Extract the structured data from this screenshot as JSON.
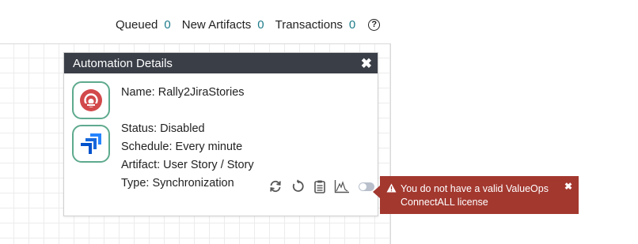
{
  "status_bar": {
    "queued_label": "Queued",
    "queued_count": "0",
    "new_artifacts_label": "New Artifacts",
    "new_artifacts_count": "0",
    "transactions_label": "Transactions",
    "transactions_count": "0",
    "help_icon": "help-circle-icon"
  },
  "panel": {
    "title": "Automation Details",
    "close_glyph": "✖",
    "name": "Name: Rally2JiraStories",
    "status": "Status: Disabled",
    "schedule": "Schedule: Every minute",
    "artifact": "Artifact: User Story / Story",
    "type": "Type: Synchronization",
    "source_app_icon": "rally-logo-icon",
    "target_app_icon": "jira-logo-icon",
    "toolbar_icons": [
      "sync-icon",
      "reset-icon",
      "clipboard-icon",
      "chart-icon"
    ],
    "enabled": false
  },
  "alert": {
    "message_line1": "You do not have a valid ValueOps",
    "message_line2": "ConnectALL license",
    "close_glyph": "✖",
    "icon": "warning-icon"
  },
  "colors": {
    "header_bg": "#3a3e47",
    "alert_bg": "#a3382f",
    "tile_border": "#5eaa8e",
    "count_color": "#1d7b8a",
    "rally_red": "#d2494b",
    "jira_blue": "#2684ff"
  }
}
